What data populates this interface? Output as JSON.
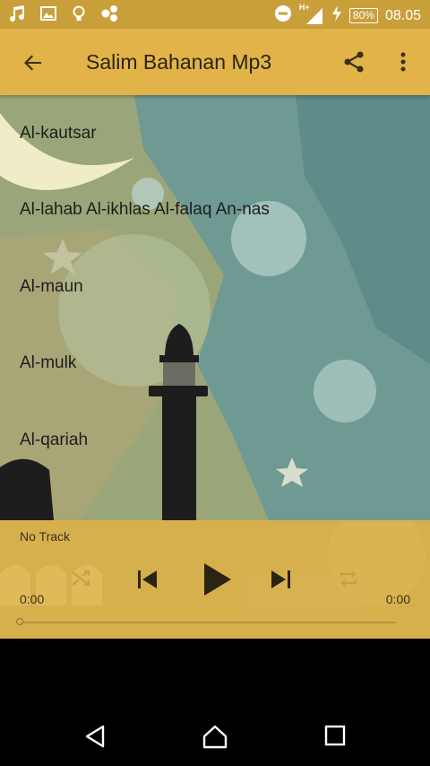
{
  "status_bar": {
    "time": "08.05",
    "battery": "80%",
    "network": "H+",
    "left_icons": [
      "music-note-icon",
      "image-icon",
      "lightbulb-icon",
      "apps-icon"
    ],
    "right_icons": [
      "do-not-disturb-icon",
      "signal-icon",
      "charging-icon",
      "battery-icon"
    ]
  },
  "app_bar": {
    "title": "Salim Bahanan Mp3",
    "icons": [
      "back-arrow-icon",
      "share-icon",
      "more-vert-icon"
    ],
    "color": "#e1b348"
  },
  "playlist": [
    {
      "label": "Al-kautsar"
    },
    {
      "label": "Al-lahab Al-ikhlas Al-falaq An-nas"
    },
    {
      "label": "Al-maun"
    },
    {
      "label": "Al-mulk"
    },
    {
      "label": "Al-qariah"
    }
  ],
  "player": {
    "track": "No Track",
    "current_time": "0:00",
    "total_time": "0:00",
    "progress": 0,
    "controls": [
      "shuffle-icon",
      "skip-previous-icon",
      "play-icon",
      "skip-next-icon",
      "repeat-icon"
    ]
  },
  "nav_bar": {
    "icons": [
      "back-triangle-icon",
      "home-icon",
      "recents-icon"
    ]
  },
  "colors": {
    "status_bar": "#c99f3a",
    "player_bg": "#d6b04c",
    "text_dark": "#1d1d1d"
  }
}
